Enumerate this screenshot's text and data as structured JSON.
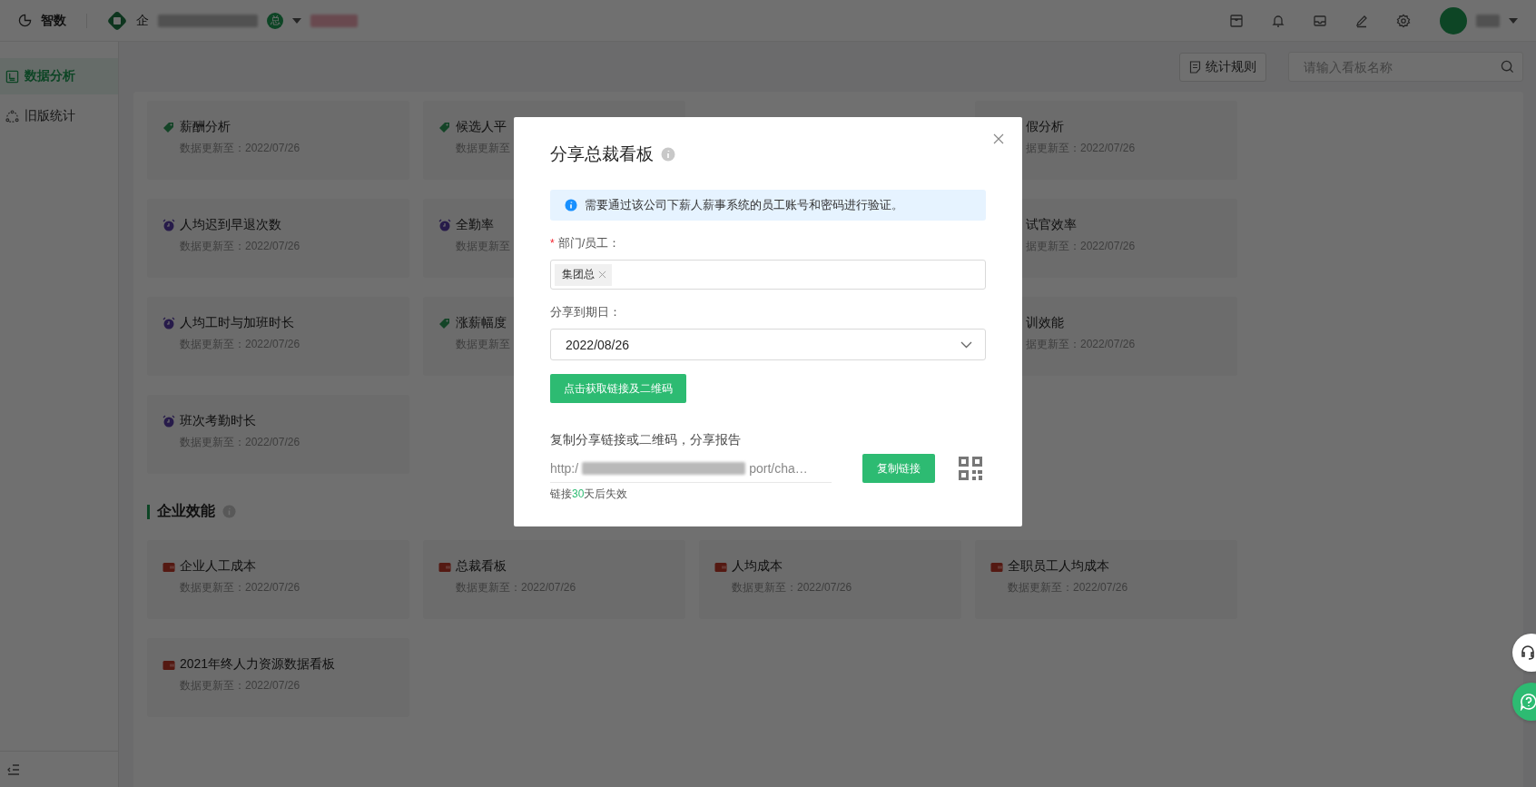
{
  "topbar": {
    "app_name": "智数",
    "org_prefix": "企",
    "org_badge": "总"
  },
  "sidebar": {
    "items": [
      {
        "label": "数据分析",
        "selected": true
      },
      {
        "label": "旧版统计",
        "selected": false
      }
    ]
  },
  "toolbar": {
    "rules_button": "统计规则",
    "search_placeholder": "请输入看板名称"
  },
  "sections": [
    {
      "rows": [
        [
          {
            "kind": "tag",
            "title": "薪酬分析",
            "updated": "数据更新至：2022/07/26"
          },
          {
            "kind": "tag",
            "title": "候选人平",
            "updated": "数据更新至"
          },
          null,
          {
            "kind": "covered",
            "title": "假分析",
            "updated": "据更新至：2022/07/26"
          }
        ],
        [
          {
            "kind": "clock",
            "title": "人均迟到早退次数",
            "updated": "数据更新至：2022/07/26"
          },
          {
            "kind": "clock",
            "title": "全勤率",
            "updated": "数据更新至"
          },
          null,
          {
            "kind": "covered",
            "title": "试官效率",
            "updated": "据更新至：2022/07/26"
          }
        ],
        [
          {
            "kind": "clock",
            "title": "人均工时与加班时长",
            "updated": "数据更新至：2022/07/26"
          },
          {
            "kind": "tag",
            "title": "涨薪幅度",
            "updated": "数据更新至"
          },
          null,
          {
            "kind": "covered",
            "title": "训效能",
            "updated": "据更新至：2022/07/26"
          }
        ],
        [
          {
            "kind": "clock",
            "title": "班次考勤时长",
            "updated": "数据更新至：2022/07/26"
          }
        ]
      ]
    },
    {
      "title": "企业效能",
      "rows": [
        [
          {
            "kind": "wallet",
            "title": "企业人工成本",
            "updated": "数据更新至：2022/07/26"
          },
          {
            "kind": "wallet",
            "title": "总裁看板",
            "updated": "数据更新至：2022/07/26"
          },
          {
            "kind": "wallet",
            "title": "人均成本",
            "updated": "数据更新至：2022/07/26"
          },
          {
            "kind": "wallet",
            "title": "全职员工人均成本",
            "updated": "数据更新至：2022/07/26"
          }
        ],
        [
          {
            "kind": "wallet",
            "title": "2021年终人力资源数据看板",
            "updated": "数据更新至：2022/07/26"
          }
        ]
      ]
    }
  ],
  "modal": {
    "title": "分享总裁看板",
    "alert": "需要通过该公司下薪人薪事系统的员工账号和密码进行验证。",
    "dept_required_mark": "*",
    "dept_label": "部门/员工：",
    "dept_tags": [
      "集团总"
    ],
    "date_label": "分享到期日：",
    "date_value": "2022/08/26",
    "generate_button": "点击获取链接及二维码",
    "share_hint": "复制分享链接或二维码，分享报告",
    "link_start": "http:/",
    "link_end": "port/cha…",
    "expiry_prefix": "链接",
    "expiry_days": "30",
    "expiry_suffix": "天后失效",
    "copy_button": "复制链接"
  }
}
